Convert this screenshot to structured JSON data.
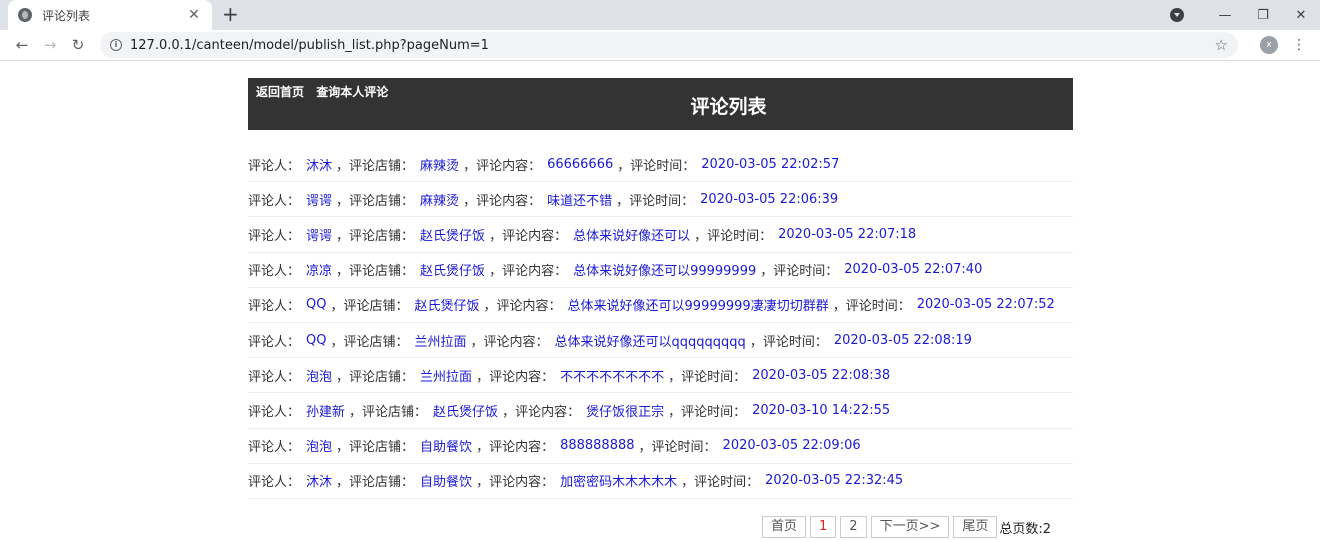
{
  "browser": {
    "tab_title": "评论列表",
    "tab_close": "✕",
    "new_tab": "+",
    "url": "127.0.0.1/canteen/model/publish_list.php?pageNum=1",
    "avatar_letter": "x",
    "minimize": "—",
    "restore": "❐",
    "close": "✕"
  },
  "header": {
    "home_link": "返回首页",
    "my_comments_link": "查询本人评论",
    "title": "评论列表"
  },
  "labels": {
    "reviewer": "评论人：",
    "shop": "，评论店铺：",
    "content": "，评论内容：",
    "time": "，评论时间："
  },
  "comments": [
    {
      "user": "沐沐",
      "shop": "麻辣烫",
      "content": "66666666",
      "time": "2020-03-05 22:02:57"
    },
    {
      "user": "谔谔",
      "shop": "麻辣烫",
      "content": "味道还不错",
      "time": "2020-03-05 22:06:39"
    },
    {
      "user": "谔谔",
      "shop": "赵氏煲仔饭",
      "content": "总体来说好像还可以",
      "time": "2020-03-05 22:07:18"
    },
    {
      "user": "凉凉",
      "shop": "赵氏煲仔饭",
      "content": "总体来说好像还可以99999999",
      "time": "2020-03-05 22:07:40"
    },
    {
      "user": "QQ",
      "shop": "赵氏煲仔饭",
      "content": "总体来说好像还可以99999999凄凄切切群群",
      "time": "2020-03-05 22:07:52"
    },
    {
      "user": "QQ",
      "shop": "兰州拉面",
      "content": "总体来说好像还可以qqqqqqqqq",
      "time": "2020-03-05 22:08:19"
    },
    {
      "user": "泡泡",
      "shop": "兰州拉面",
      "content": "不不不不不不不不",
      "time": "2020-03-05 22:08:38"
    },
    {
      "user": "孙建新",
      "shop": "赵氏煲仔饭",
      "content": "煲仔饭很正宗",
      "time": "2020-03-10 14:22:55"
    },
    {
      "user": "泡泡",
      "shop": "自助餐饮",
      "content": "888888888",
      "time": "2020-03-05 22:09:06"
    },
    {
      "user": "沐沐",
      "shop": "自助餐饮",
      "content": "加密密码木木木木木",
      "time": "2020-03-05 22:32:45"
    }
  ],
  "pager": {
    "first": "首页",
    "page1": "1",
    "page2": "2",
    "next": "下一页>>",
    "last": "尾页",
    "total": "总页数:2"
  }
}
